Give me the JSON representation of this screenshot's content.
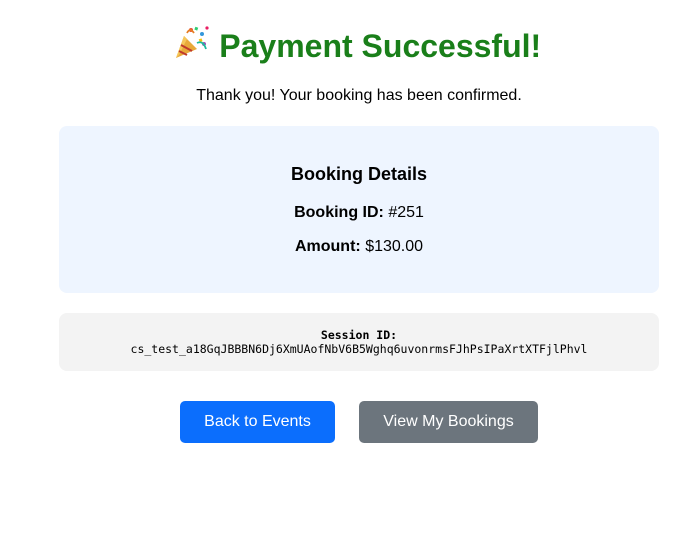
{
  "header": {
    "title": "Payment Successful!",
    "icon": "party-popper-icon",
    "title_color": "#1a7f1a"
  },
  "message": "Thank you! Your booking has been confirmed.",
  "booking_details": {
    "heading": "Booking Details",
    "booking_id_label": "Booking ID:",
    "booking_id_value": "#251",
    "amount_label": "Amount:",
    "amount_value": "$130.00"
  },
  "session": {
    "label": "Session ID:",
    "value": "cs_test_a18GqJBBBN6Dj6XmUAofNbV6B5Wghq6uvonrmsFJhPsIPaXrtXTFjlPhvl"
  },
  "actions": {
    "back_label": "Back to Events",
    "bookings_label": "View My Bookings",
    "primary_color": "#0b6efd",
    "secondary_color": "#6c757d"
  }
}
